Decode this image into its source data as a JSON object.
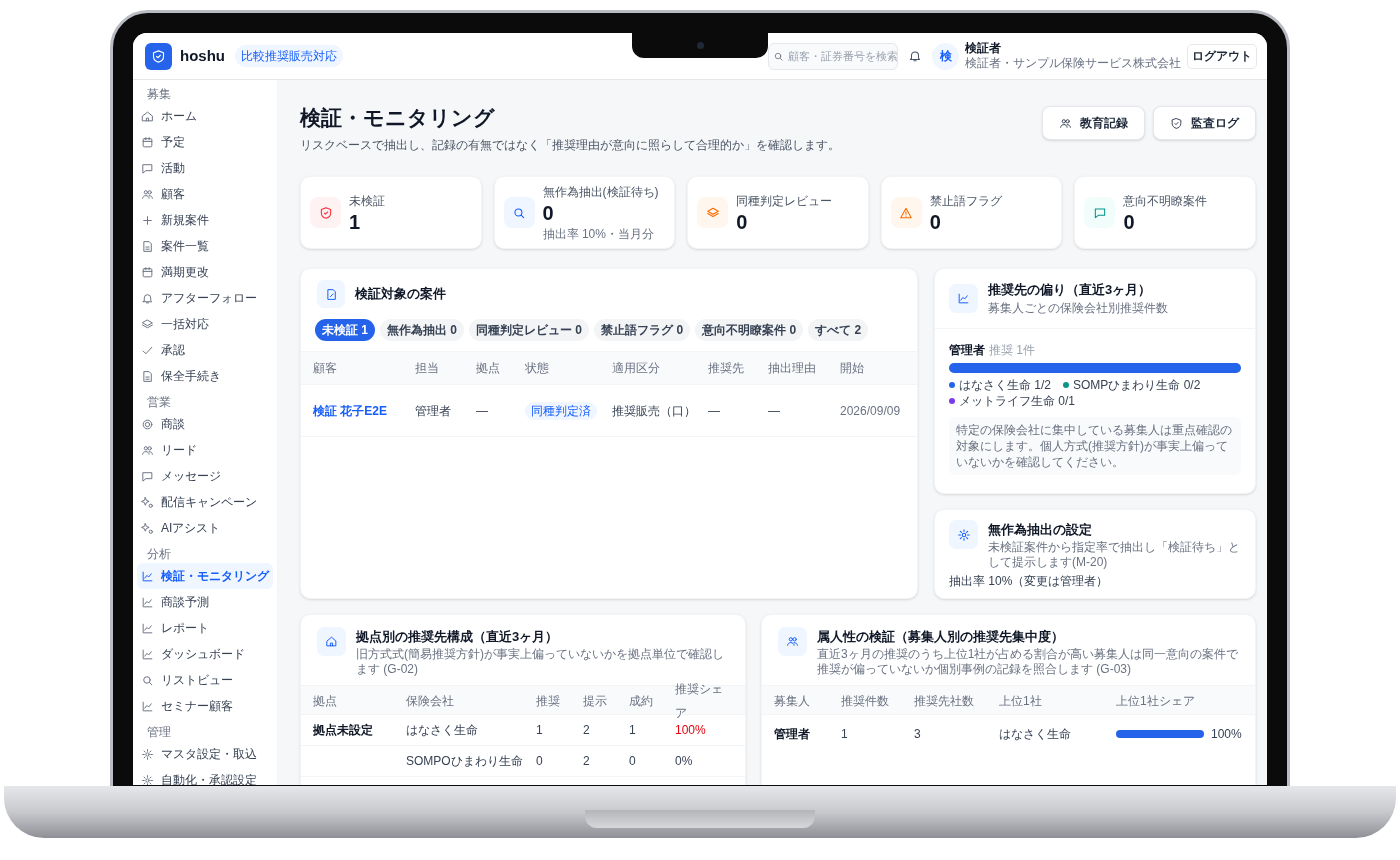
{
  "header": {
    "brand": "hoshu",
    "badge": "比較推奨販売対応",
    "search_placeholder": "顧客・証券番号を検索",
    "user_initial": "検",
    "user_name": "検証者",
    "user_role": "検証者・サンプル保険サービス株式会社",
    "logout": "ログアウト"
  },
  "sidebar": [
    {
      "label": "募集",
      "items": [
        {
          "label": "ホーム",
          "selected": false
        },
        {
          "label": "予定",
          "selected": false
        },
        {
          "label": "活動",
          "selected": false
        },
        {
          "label": "顧客",
          "selected": false
        },
        {
          "label": "新規案件",
          "selected": false
        },
        {
          "label": "案件一覧",
          "selected": false
        },
        {
          "label": "満期更改",
          "selected": false
        },
        {
          "label": "アフターフォロー",
          "selected": false
        },
        {
          "label": "一括対応",
          "selected": false
        },
        {
          "label": "承認",
          "selected": false
        },
        {
          "label": "保全手続き",
          "selected": false
        }
      ]
    },
    {
      "label": "営業",
      "items": [
        {
          "label": "商談",
          "selected": false
        },
        {
          "label": "リード",
          "selected": false
        },
        {
          "label": "メッセージ",
          "selected": false
        },
        {
          "label": "配信キャンペーン",
          "selected": false
        },
        {
          "label": "AIアシスト",
          "selected": false
        }
      ]
    },
    {
      "label": "分析",
      "items": [
        {
          "label": "検証・モニタリング",
          "selected": true
        },
        {
          "label": "商談予測",
          "selected": false
        },
        {
          "label": "レポート",
          "selected": false
        },
        {
          "label": "ダッシュボード",
          "selected": false
        },
        {
          "label": "リストビュー",
          "selected": false
        },
        {
          "label": "セミナー顧客",
          "selected": false
        }
      ]
    },
    {
      "label": "管理",
      "items": [
        {
          "label": "マスタ設定・取込",
          "selected": false
        },
        {
          "label": "自動化・承認設定",
          "selected": false
        }
      ]
    }
  ],
  "page": {
    "title": "検証・モニタリング",
    "subtitle": "リスクベースで抽出し、記録の有無ではなく「推奨理由が意向に照らして合理的か」を確認します。",
    "buttons": [
      "教育記録",
      "監査ログ"
    ]
  },
  "stats": [
    {
      "label": "未検証",
      "value": "1"
    },
    {
      "label": "無作為抽出(検証待ち)",
      "value": "0",
      "note": "抽出率 10%・当月分"
    },
    {
      "label": "同種判定レビュー",
      "value": "0"
    },
    {
      "label": "禁止語フラグ",
      "value": "0"
    },
    {
      "label": "意向不明瞭案件",
      "value": "0"
    }
  ],
  "cases": {
    "title": "検証対象の案件",
    "filters": [
      {
        "label": "未検証 1",
        "selected": true
      },
      {
        "label": "無作為抽出 0",
        "selected": false
      },
      {
        "label": "同種判定レビュー 0",
        "selected": false
      },
      {
        "label": "禁止語フラグ 0",
        "selected": false
      },
      {
        "label": "意向不明瞭案件 0",
        "selected": false
      },
      {
        "label": "すべて 2",
        "selected": false
      }
    ],
    "columns": [
      "顧客",
      "担当",
      "拠点",
      "状態",
      "適用区分",
      "推奨先",
      "抽出理由",
      "開始"
    ],
    "rows": [
      {
        "customer": "検証 花子E2E",
        "owner": "管理者",
        "branch": "—",
        "status": "同種判定済",
        "category": "推奨販売（口）",
        "recommended": "—",
        "reason": "—",
        "start": "2026/09/09"
      }
    ]
  },
  "bias": {
    "title": "推奨先の偏り（直近3ヶ月）",
    "subtitle": "募集人ごとの保険会社別推奨件数",
    "agent": "管理者",
    "count": "推奨 1件",
    "level": 1,
    "legend": [
      {
        "label": "はなさく生命 1/2",
        "color": "#2563eb"
      },
      {
        "label": "SOMPひまわり生命 0/2",
        "color": "#0d9488"
      },
      {
        "label": "メットライフ生命 0/1",
        "color": "#7c3aed"
      }
    ],
    "note": "特定の保険会社に集中している募集人は重点確認の対象にします。個人方式(推奨方針)が事実上偏っていないかを確認してください。"
  },
  "random": {
    "title": "無作為抽出の設定",
    "description": "未検証案件から指定率で抽出し「検証待ち」として提示します(M-20)",
    "rate": "抽出率 10%（変更は管理者）"
  },
  "branch": {
    "title": "拠点別の推奨先構成（直近3ヶ月）",
    "subtitle": "旧方式式(簡易推奨方針)が事実上偏っていないかを拠点単位で確認します (G-02)",
    "columns": [
      "拠点",
      "保険会社",
      "推奨",
      "提示",
      "成約",
      "推奨シェア"
    ],
    "rows": [
      {
        "cells": [
          "拠点未設定",
          "はなさく生命",
          "1",
          "2",
          "1",
          "100%"
        ],
        "alert": true
      },
      {
        "cells": [
          "",
          "SOMPOひまわり生命",
          "0",
          "2",
          "0",
          "0%"
        ],
        "alert": false
      }
    ]
  },
  "personal": {
    "title": "属人性の検証（募集人別の推奨先集中度）",
    "subtitle": "直近3ヶ月の推奨のうち上位1社が占める割合が高い募集人は同一意向の案件で推奨が偏っていないか個別事例の記録を照合します (G-03)",
    "columns": [
      "募集人",
      "推奨件数",
      "推奨先社数",
      "上位1社",
      "上位1社シェア"
    ],
    "rows": [
      {
        "agent": "管理者",
        "count": "1",
        "companies": "3",
        "top": "はなさく生命",
        "level": 1,
        "share": "100%"
      }
    ]
  }
}
